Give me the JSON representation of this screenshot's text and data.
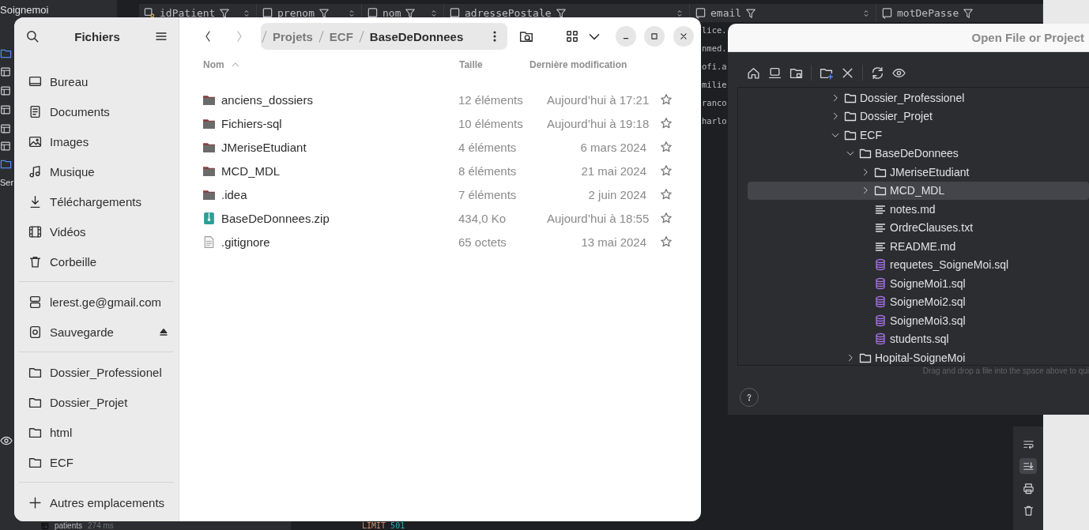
{
  "ide": {
    "project": "Soignemoi",
    "tool_label": "Ser",
    "columns": [
      {
        "name": "idPatient",
        "kind": "key"
      },
      {
        "name": "prenom",
        "kind": "column"
      },
      {
        "name": "nom",
        "kind": "column"
      },
      {
        "name": "adressePostale",
        "kind": "column"
      },
      {
        "name": "email",
        "kind": "column"
      },
      {
        "name": "motDePasse",
        "kind": "column"
      }
    ],
    "email_cells": [
      "lice.",
      "nmed.",
      "ofi.a",
      "milie",
      "ranco",
      "harlo"
    ],
    "result_item": {
      "name": "patients",
      "time": "274 ms"
    },
    "query_line": {
      "keyword": "LIMIT",
      "number": "501"
    }
  },
  "files_window": {
    "title": "Fichiers",
    "sidebar_sections": [
      {
        "items": [
          {
            "label": "Bureau",
            "kind": "desktop"
          },
          {
            "label": "Documents",
            "kind": "documents"
          },
          {
            "label": "Images",
            "kind": "images"
          },
          {
            "label": "Musique",
            "kind": "music"
          },
          {
            "label": "Téléchargements",
            "kind": "downloads"
          },
          {
            "label": "Vidéos",
            "kind": "videos"
          },
          {
            "label": "Corbeille",
            "kind": "trash"
          }
        ]
      },
      {
        "items": [
          {
            "label": "lerest.ge@gmail.com",
            "kind": "account"
          },
          {
            "label": "Sauvegarde",
            "kind": "drive",
            "ejectable": true
          }
        ]
      },
      {
        "items": [
          {
            "label": "Dossier_Professionel",
            "kind": "bookmark"
          },
          {
            "label": "Dossier_Projet",
            "kind": "bookmark"
          },
          {
            "label": "html",
            "kind": "bookmark"
          },
          {
            "label": "ECF",
            "kind": "bookmark"
          }
        ]
      },
      {
        "items": [
          {
            "label": "Autres emplacements",
            "kind": "other"
          }
        ]
      }
    ],
    "path": [
      "Projets",
      "ECF",
      "BaseDeDonnees"
    ],
    "columns": [
      {
        "label": "Nom",
        "sort_ascending": true
      },
      {
        "label": "Taille"
      },
      {
        "label": "Dernière modification"
      }
    ],
    "rows": [
      {
        "name": "anciens_dossiers",
        "kind": "folder",
        "size": "12 éléments",
        "modified": "Aujourd’hui à 17:21",
        "starred": false
      },
      {
        "name": "Fichiers-sql",
        "kind": "folder",
        "size": "10 éléments",
        "modified": "Aujourd’hui à 19:18",
        "starred": false
      },
      {
        "name": "JMeriseEtudiant",
        "kind": "folder",
        "size": "4 éléments",
        "modified": "6 mars 2024",
        "starred": false
      },
      {
        "name": "MCD_MDL",
        "kind": "folder",
        "size": "8 éléments",
        "modified": "21 mai 2024",
        "starred": false
      },
      {
        "name": ".idea",
        "kind": "folder",
        "size": "7 éléments",
        "modified": "2 juin 2024",
        "starred": false
      },
      {
        "name": "BaseDeDonnees.zip",
        "kind": "zip",
        "size": "434,0 Ko",
        "modified": "Aujourd’hui à 18:55",
        "starred": false
      },
      {
        "name": ".gitignore",
        "kind": "text",
        "size": "65 octets",
        "modified": "13 mai 2024",
        "starred": false
      }
    ]
  },
  "open_dialog": {
    "title": "Open File or Project",
    "tree": [
      {
        "name": "Dossier_Professionel",
        "kind": "folder",
        "expanded": false,
        "selected": false
      },
      {
        "name": "Dossier_Projet",
        "kind": "folder",
        "expanded": false,
        "selected": false
      },
      {
        "name": "ECF",
        "kind": "folder",
        "expanded": true,
        "selected": false,
        "children": [
          {
            "name": "BaseDeDonnees",
            "kind": "folder",
            "expanded": true,
            "selected": false,
            "children": [
              {
                "name": "JMeriseEtudiant",
                "kind": "folder",
                "expanded": false,
                "selected": false
              },
              {
                "name": "MCD_MDL",
                "kind": "folder",
                "expanded": false,
                "selected": true
              },
              {
                "name": "notes.md",
                "kind": "text",
                "selected": false
              },
              {
                "name": "OrdreClauses.txt",
                "kind": "text",
                "selected": false
              },
              {
                "name": "README.md",
                "kind": "text",
                "selected": false
              },
              {
                "name": "requetes_SoigneMoi.sql",
                "kind": "sql",
                "selected": false
              },
              {
                "name": "SoigneMoi1.sql",
                "kind": "sql",
                "selected": false
              },
              {
                "name": "SoigneMoi2.sql",
                "kind": "sql",
                "selected": false
              },
              {
                "name": "SoigneMoi3.sql",
                "kind": "sql",
                "selected": false
              },
              {
                "name": "students.sql",
                "kind": "sql",
                "selected": false
              }
            ]
          },
          {
            "name": "Hopital-SoigneMoi",
            "kind": "folder",
            "expanded": false,
            "selected": false
          }
        ]
      }
    ],
    "hint": "Drag and drop a file into the space above to qui"
  }
}
